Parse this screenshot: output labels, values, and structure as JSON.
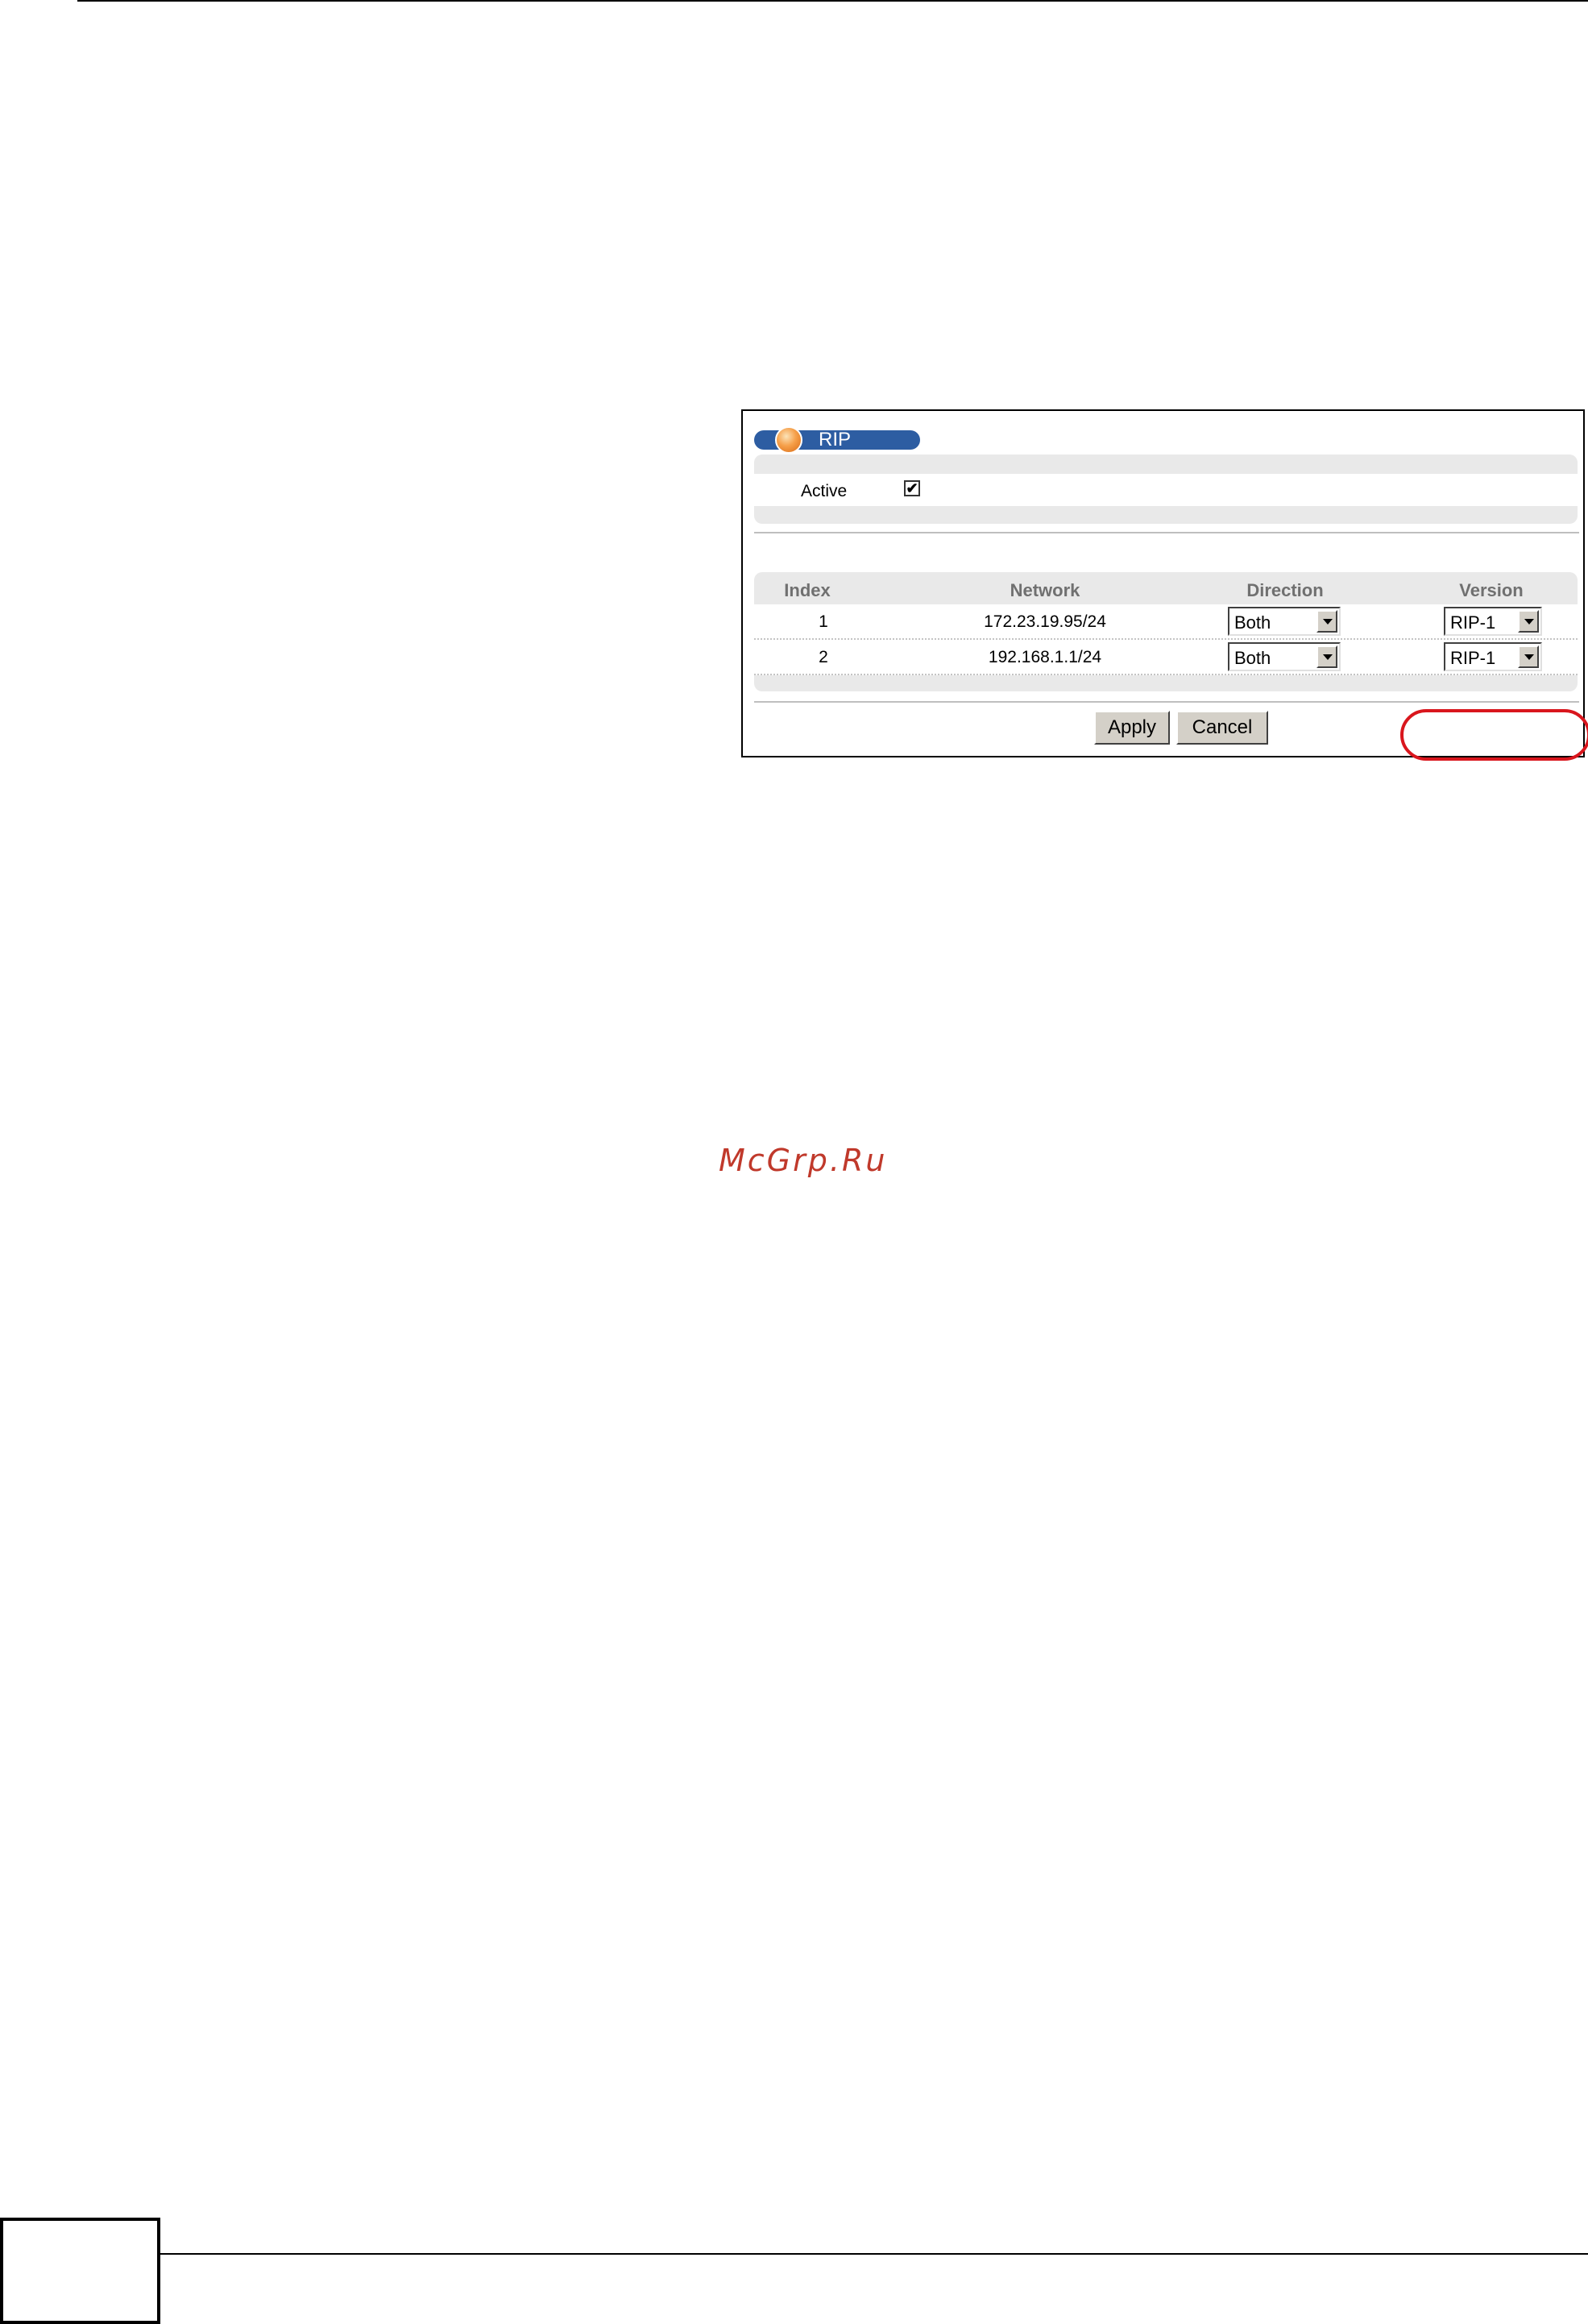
{
  "panel": {
    "title": "RIP",
    "active": {
      "label": "Active",
      "checked": true,
      "check_mark": "✔"
    },
    "table": {
      "headers": {
        "index": "Index",
        "network": "Network",
        "direction": "Direction",
        "version": "Version"
      },
      "rows": [
        {
          "index": "1",
          "network": "172.23.19.95/24",
          "direction": "Both",
          "version": "RIP-1"
        },
        {
          "index": "2",
          "network": "192.168.1.1/24",
          "direction": "Both",
          "version": "RIP-1"
        }
      ]
    },
    "buttons": {
      "apply": "Apply",
      "cancel": "Cancel"
    }
  },
  "watermark": "McGrp.Ru",
  "colors": {
    "title_bar": "#2d5da2",
    "callout": "#d9161d",
    "watermark": "#c0392b"
  }
}
